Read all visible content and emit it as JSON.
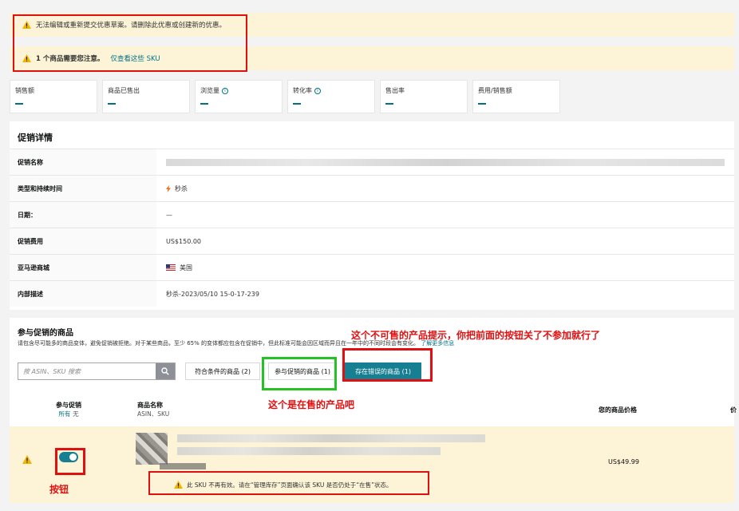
{
  "alerts": {
    "cannot_edit": "无法编辑或重新提交优惠草案。请删除此优惠或创建新的优惠。",
    "attention_bold": "1 个商品需要您注意。",
    "attention_link": "仅查看这些 SKU"
  },
  "metrics": [
    {
      "label": "销售额",
      "value": "—",
      "info": false
    },
    {
      "label": "商品已售出",
      "value": "—",
      "info": false
    },
    {
      "label": "浏览量",
      "value": "—",
      "info": true
    },
    {
      "label": "转化率",
      "value": "—",
      "info": true
    },
    {
      "label": "售出率",
      "value": "—",
      "info": false
    },
    {
      "label": "费用/销售额",
      "value": "—",
      "info": false
    }
  ],
  "details": {
    "title": "促销详情",
    "rows": [
      {
        "key": "促销名称",
        "value": ""
      },
      {
        "key": "类型和持续时间",
        "value": "秒杀"
      },
      {
        "key": "日期：",
        "value": "—"
      },
      {
        "key": "促销费用",
        "value": "US$150.00"
      },
      {
        "key": "亚马逊商城",
        "value": "美国"
      },
      {
        "key": "内部描述",
        "value": "秒杀-2023/05/10 15-0-17-239"
      }
    ]
  },
  "participating": {
    "title": "参与促销的商品",
    "desc": "请包含尽可能多的商品变体，避免促销被拒绝。对于某些商品，至少 65% 的变体都应包含在促销中，但此标准可能会因区域而异且在一年中的不同时段会有变化。",
    "more": "了解更多信息",
    "search_placeholder": "按 ASIN、SKU 搜索",
    "tabs": [
      "符合条件的商品 (2)",
      "参与促销的商品 (1)",
      "存在错误的商品 (1)"
    ]
  },
  "table": {
    "col_participate": "参与促销",
    "participate_all": "所有",
    "participate_none": "无",
    "col_name": "商品名称",
    "col_name_sub": "ASIN、SKU",
    "col_price": "您的商品价格",
    "col_next": "价",
    "row_price": "US$49.99",
    "row_notice": "此 SKU 不再有效。请在“管理库存”页面确认该 SKU 是否仍处于“在售”状态。"
  },
  "annotations": {
    "unsellable": "这个不可售的产品提示，你把前面的按钮关了不参加就行了",
    "on_sale": "这个是在售的产品吧",
    "button": "按钮"
  },
  "colors": {
    "accent": "#167f92",
    "link": "#007185",
    "warning_bg": "#fdf4d7",
    "annotation": "#e01010",
    "annotation_green": "#24c224"
  }
}
